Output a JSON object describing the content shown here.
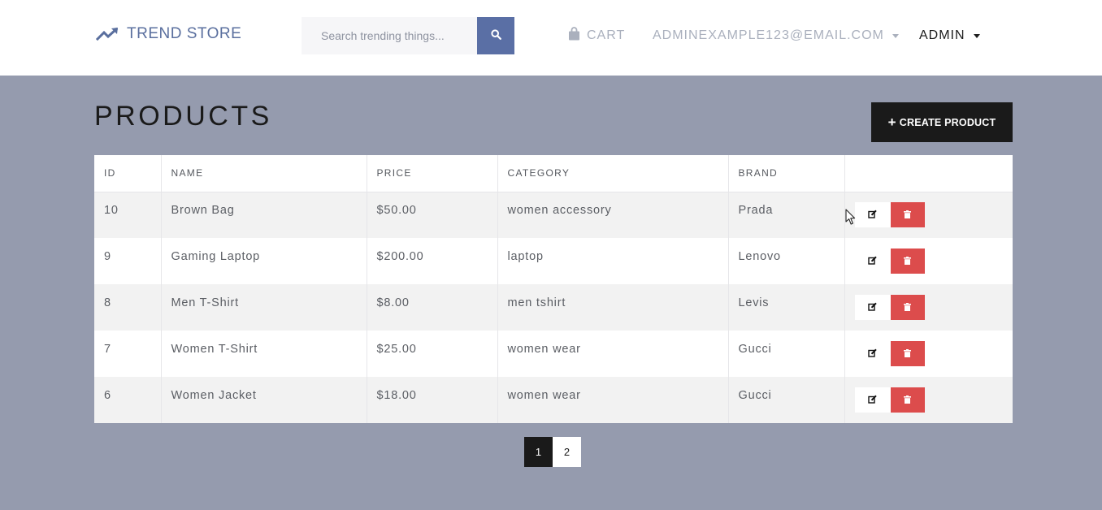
{
  "navbar": {
    "brand": "TREND STORE",
    "search_placeholder": "Search trending things...",
    "cart_label": "CART",
    "user_email": "ADMINEXAMPLE123@EMAIL.COM",
    "admin_label": "ADMIN"
  },
  "page": {
    "title": "PRODUCTS",
    "create_button": "CREATE PRODUCT"
  },
  "table": {
    "headers": [
      "ID",
      "NAME",
      "PRICE",
      "CATEGORY",
      "BRAND",
      ""
    ],
    "rows": [
      {
        "id": "10",
        "name": "Brown Bag",
        "price": "$50.00",
        "category": "women accessory",
        "brand": "Prada"
      },
      {
        "id": "9",
        "name": "Gaming Laptop",
        "price": "$200.00",
        "category": "laptop",
        "brand": "Lenovo"
      },
      {
        "id": "8",
        "name": "Men T-Shirt",
        "price": "$8.00",
        "category": "men tshirt",
        "brand": "Levis"
      },
      {
        "id": "7",
        "name": "Women T-Shirt",
        "price": "$25.00",
        "category": "women wear",
        "brand": "Gucci"
      },
      {
        "id": "6",
        "name": "Women Jacket",
        "price": "$18.00",
        "category": "women wear",
        "brand": "Gucci"
      }
    ]
  },
  "pagination": {
    "pages": [
      "1",
      "2"
    ],
    "active": "1"
  },
  "colors": {
    "background": "#959bae",
    "brand": "#5a6f9e",
    "search_button": "#5a6fa5",
    "delete_button": "#dc4c4c",
    "dark": "#1a1a1a"
  },
  "icons": {
    "brand": "trending-up-icon",
    "search": "search-icon",
    "cart": "shopping-bag-icon",
    "edit": "edit-icon",
    "delete": "trash-icon"
  }
}
